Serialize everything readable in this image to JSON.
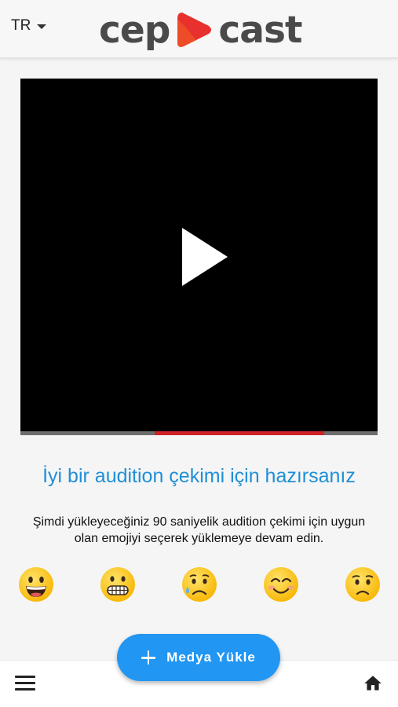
{
  "header": {
    "language": "TR",
    "logo_left": "cep",
    "logo_right": "cast"
  },
  "video": {
    "progress_start_fraction": 0.375,
    "progress_end_fraction": 0.85
  },
  "content": {
    "title": "İyi bir audition çekimi için hazırsanız",
    "description": "Şimdi yükleyeceğiniz 90 saniyelik audition çekimi için uygun olan emojiyi seçerek yüklemeye devam edin."
  },
  "emojis": [
    "grinning-face",
    "grimacing-face",
    "sad-sweat-face",
    "smiling-blush-face",
    "worried-face"
  ],
  "fab": {
    "label": "Medya Yükle"
  },
  "colors": {
    "accent_blue": "#2196f3",
    "title_blue": "#1f8fd6",
    "progress_red": "#d02127",
    "logo_red": "#e8312f"
  }
}
